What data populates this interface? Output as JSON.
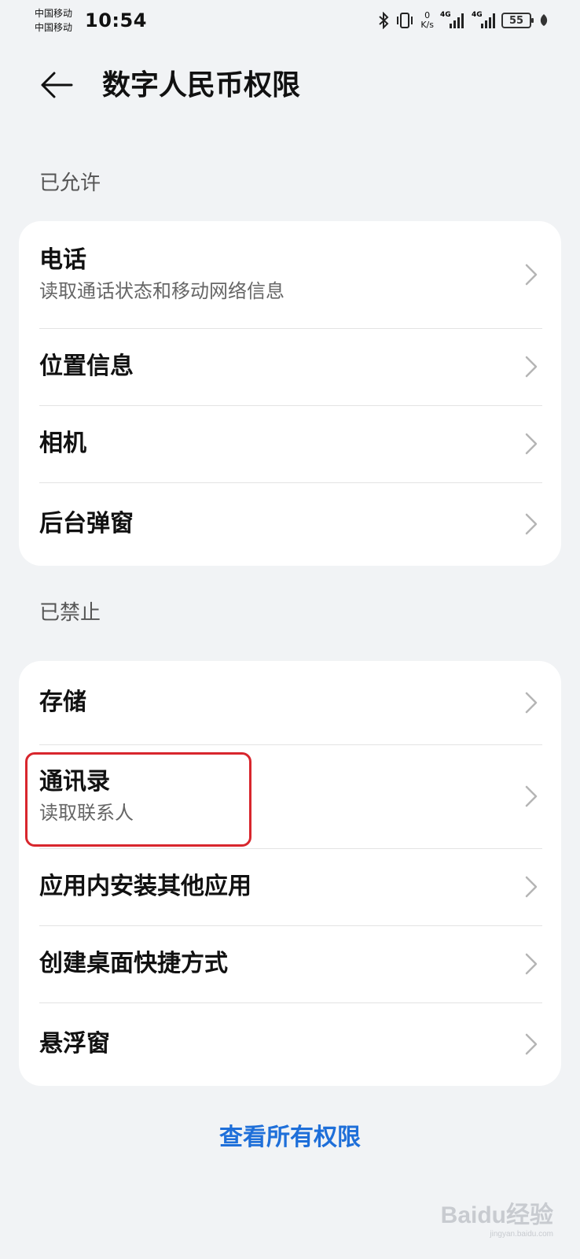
{
  "status_bar": {
    "carrier_1": "中国移动",
    "carrier_2": "中国移动",
    "time": "10:54",
    "net_speed_value": "0",
    "net_speed_unit": "K/s",
    "sim1_tag": "4G",
    "sim2_tag": "4G",
    "battery": "55",
    "icons": [
      "bluetooth-icon",
      "vibrate-icon",
      "signal-icon",
      "signal-icon",
      "battery-icon",
      "leaf-icon"
    ]
  },
  "header": {
    "back_icon": "arrow-left-icon",
    "title": "数字人民币权限"
  },
  "allowed": {
    "label": "已允许",
    "items": [
      {
        "title": "电话",
        "subtitle": "读取通话状态和移动网络信息"
      },
      {
        "title": "位置信息"
      },
      {
        "title": "相机"
      },
      {
        "title": "后台弹窗"
      }
    ]
  },
  "denied": {
    "label": "已禁止",
    "items": [
      {
        "title": "存储"
      },
      {
        "title": "通讯录",
        "subtitle": "读取联系人"
      },
      {
        "title": "应用内安装其他应用"
      },
      {
        "title": "创建桌面快捷方式"
      },
      {
        "title": "悬浮窗"
      }
    ]
  },
  "footer": {
    "view_all": "查看所有权限"
  },
  "watermark": {
    "text": "Baidu经验",
    "sub": "jingyan.baidu.com"
  },
  "colors": {
    "background": "#f1f3f5",
    "card": "#ffffff",
    "link": "#1e6fd9",
    "highlight": "#d8262d"
  }
}
